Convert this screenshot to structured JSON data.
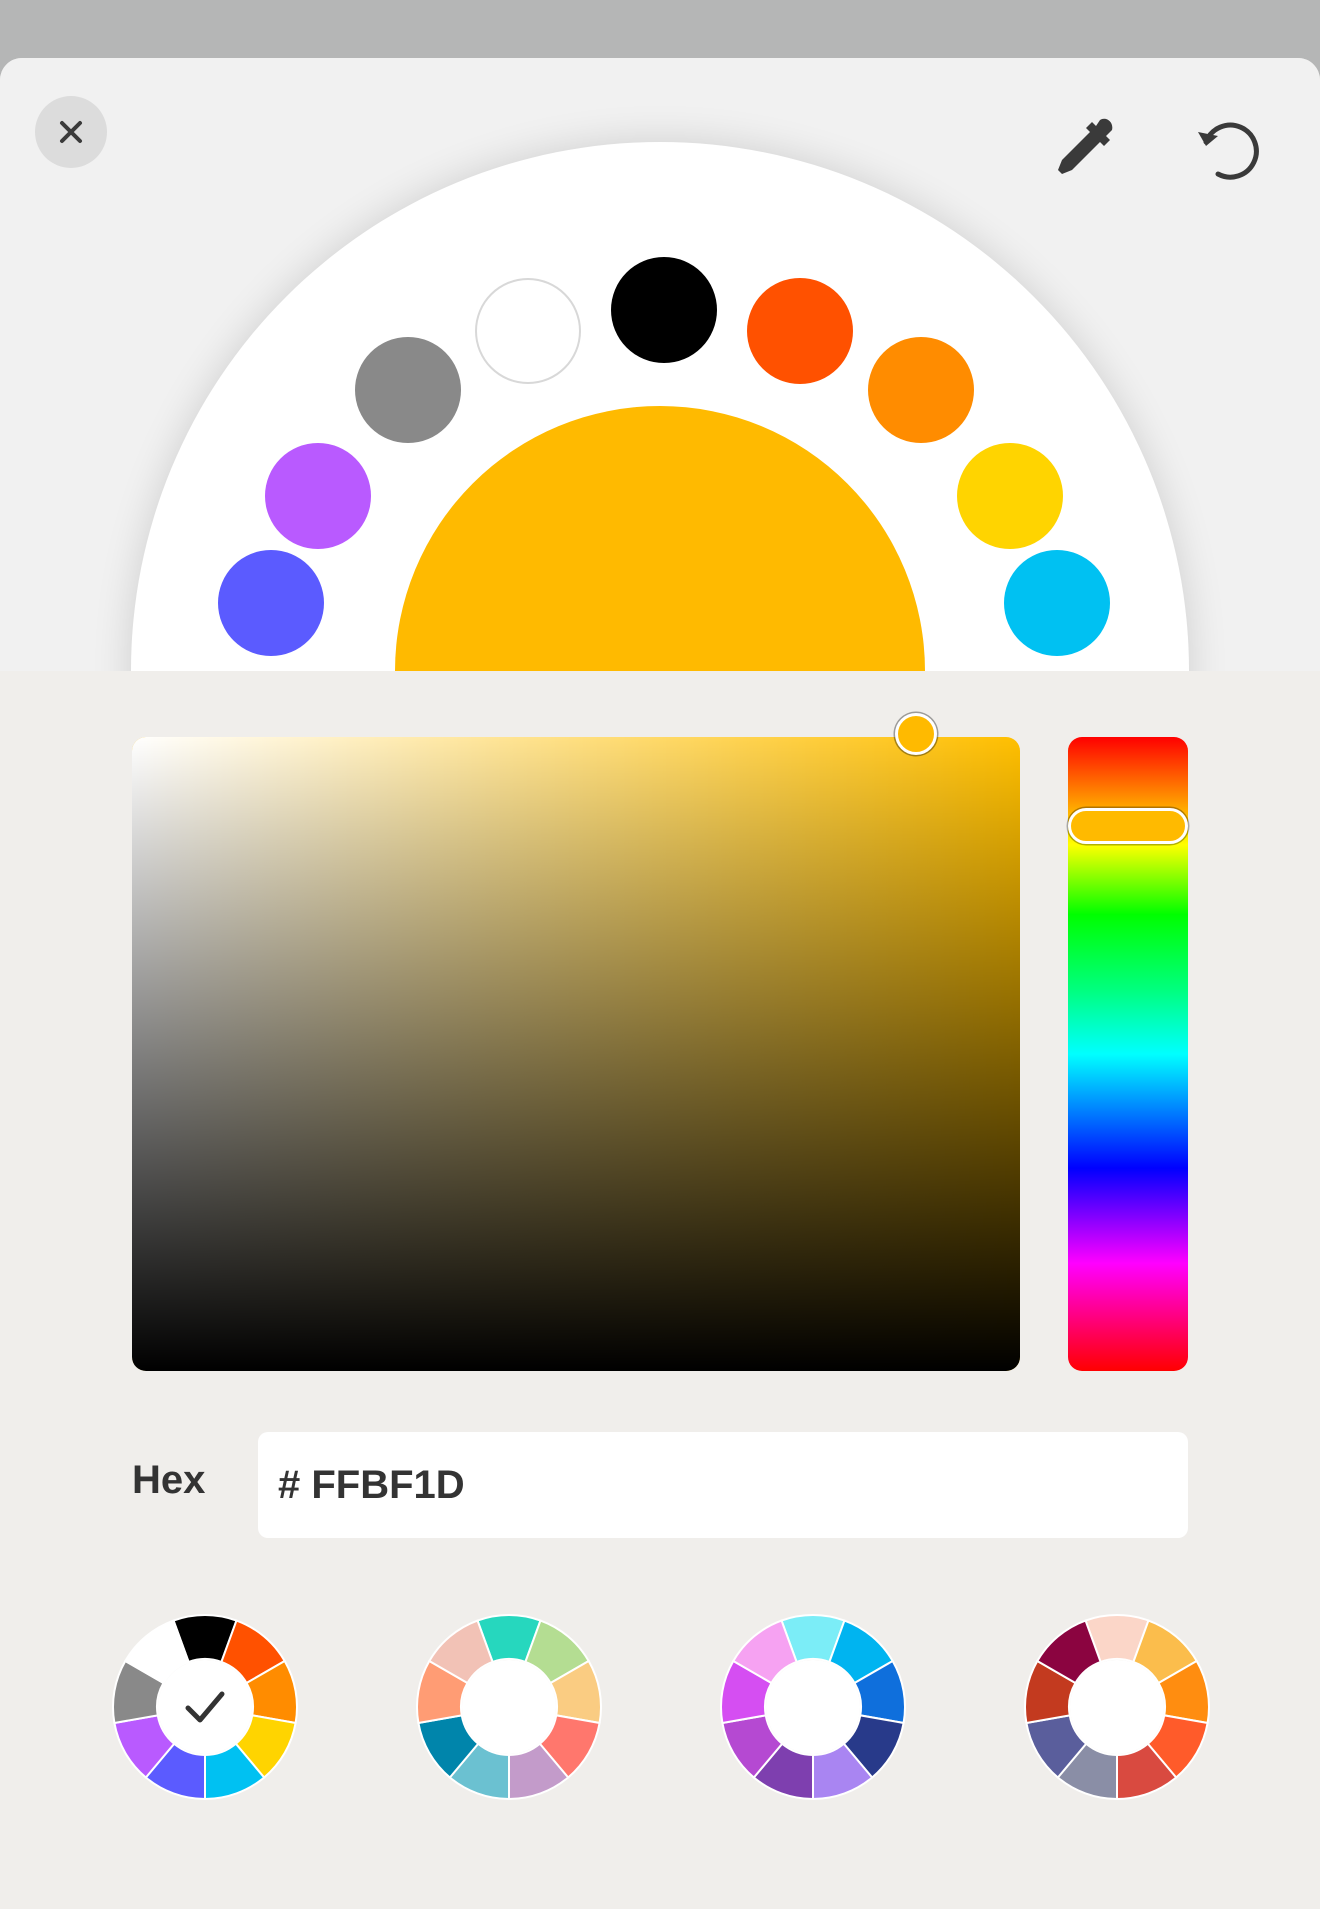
{
  "toolbar": {
    "close_icon": "close-icon",
    "eyedropper_icon": "eyedropper-icon",
    "reset_icon": "undo-icon"
  },
  "current_color": "#FFBA00",
  "swatches": [
    {
      "name": "swatch-blue",
      "color": "#5B5BFF"
    },
    {
      "name": "swatch-purple",
      "color": "#B95AFF"
    },
    {
      "name": "swatch-gray",
      "color": "#898989"
    },
    {
      "name": "swatch-white",
      "color": "#FFFFFF"
    },
    {
      "name": "swatch-black",
      "color": "#000000"
    },
    {
      "name": "swatch-red-orange",
      "color": "#FF5100"
    },
    {
      "name": "swatch-orange",
      "color": "#FF8C00"
    },
    {
      "name": "swatch-yellow",
      "color": "#FFD400"
    },
    {
      "name": "swatch-cyan",
      "color": "#00C1F2"
    }
  ],
  "picker": {
    "hue_color": "#FFBF00",
    "saturation": 0.89,
    "brightness": 1.0,
    "hue_degrees": 45
  },
  "hex": {
    "label": "Hex",
    "value": "# FFBF1D"
  },
  "palettes": [
    {
      "name": "palette-default",
      "selected": true,
      "colors": [
        "#000000",
        "#FF5100",
        "#FF8C00",
        "#FFD400",
        "#00C1F2",
        "#5B5BFF",
        "#B95AFF",
        "#898989",
        "#FFFFFF"
      ]
    },
    {
      "name": "palette-pastel",
      "selected": false,
      "colors": [
        "#26D7BE",
        "#B4DD92",
        "#FACC82",
        "#FF776D",
        "#C39BCA",
        "#6BC1D1",
        "#0085AB",
        "#FF9C74",
        "#F2C2B6"
      ]
    },
    {
      "name": "palette-cool",
      "selected": false,
      "colors": [
        "#7BEDF7",
        "#00B4F0",
        "#0F6FDC",
        "#283A8A",
        "#A985F2",
        "#7E3FAF",
        "#B549D2",
        "#D54EF2",
        "#F6A2F2"
      ]
    },
    {
      "name": "palette-warm",
      "selected": false,
      "colors": [
        "#FBD6C8",
        "#FBBD4C",
        "#FF8D10",
        "#FF5B2A",
        "#D94A40",
        "#8A8EA6",
        "#5A5E9C",
        "#C33A1F",
        "#8B0440"
      ]
    }
  ]
}
